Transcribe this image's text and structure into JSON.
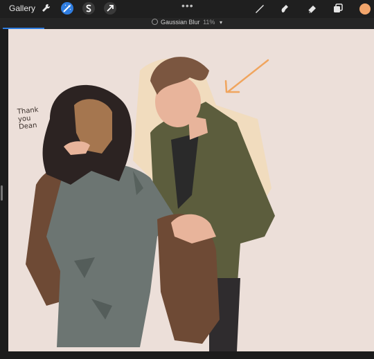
{
  "toolbar": {
    "gallery_label": "Gallery",
    "tools": [
      "wrench-icon",
      "magic-wand-icon",
      "selection-s-icon",
      "transform-arrow-icon"
    ],
    "right_tools": [
      "brush-icon",
      "smudge-icon",
      "eraser-icon",
      "layers-icon"
    ],
    "more_label": "•••",
    "color": "#f2a56b"
  },
  "status": {
    "title": "Gaussian Blur",
    "percent": "11%",
    "caret": "▾",
    "progress_fraction": 0.11
  },
  "canvas": {
    "note_lines": [
      "Thank",
      "you",
      "Dean"
    ]
  }
}
